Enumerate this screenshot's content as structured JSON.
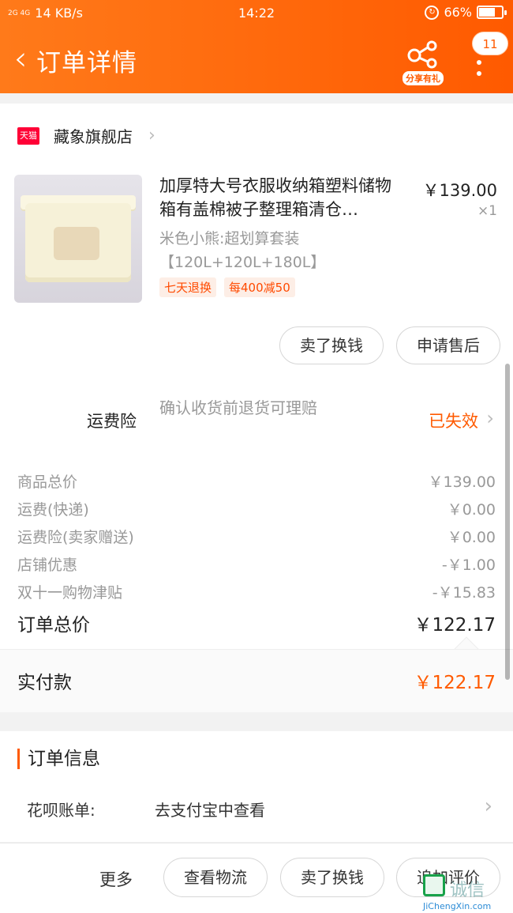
{
  "status_bar": {
    "network": "2G 4G",
    "speed": "14 KB/s",
    "time": "14:22",
    "battery": "66%"
  },
  "nav": {
    "back_icon": "chevron-left-icon",
    "title": "订单详情",
    "share_label": "分享有礼",
    "notifications": "11"
  },
  "store": {
    "badge": "天猫",
    "name": "藏象旗舰店"
  },
  "product": {
    "title": "加厚特大号衣服收纳箱塑料储物箱有盖棉被子整理箱清仓…",
    "price": "￥139.00",
    "qty": "×1",
    "sku_line1": "米色小熊:超划算套装",
    "sku_line2": "【120L+120L+180L】",
    "tags": [
      "七天退换",
      "每400减50"
    ],
    "actions": [
      "卖了换钱",
      "申请售后"
    ]
  },
  "insurance": {
    "label": "运费险",
    "desc": "确认收货前退货可理赔",
    "status": "已失效"
  },
  "summary": {
    "rows": [
      {
        "k": "商品总价",
        "v": "￥139.00"
      },
      {
        "k": "运费(快递)",
        "v": "￥0.00"
      },
      {
        "k": "运费险(卖家赠送)",
        "v": "￥0.00"
      },
      {
        "k": "店铺优惠",
        "v": "-￥1.00"
      },
      {
        "k": "双十一购物津贴",
        "v": "-￥15.83"
      }
    ],
    "total_label": "订单总价",
    "total_value": "￥122.17",
    "paid_label": "实付款",
    "paid_value": "￥122.17"
  },
  "order_info": {
    "title": "订单信息",
    "row_key": "花呗账单:",
    "row_value": "去支付宝中查看"
  },
  "bottom_bar": {
    "more": "更多",
    "buttons": [
      "查看物流",
      "卖了换钱",
      "追加评价"
    ]
  },
  "watermark": {
    "text": "诚信",
    "url": "JiChengXin.com"
  },
  "colors": {
    "accent": "#ff5a00",
    "tmall": "#ff0036"
  }
}
